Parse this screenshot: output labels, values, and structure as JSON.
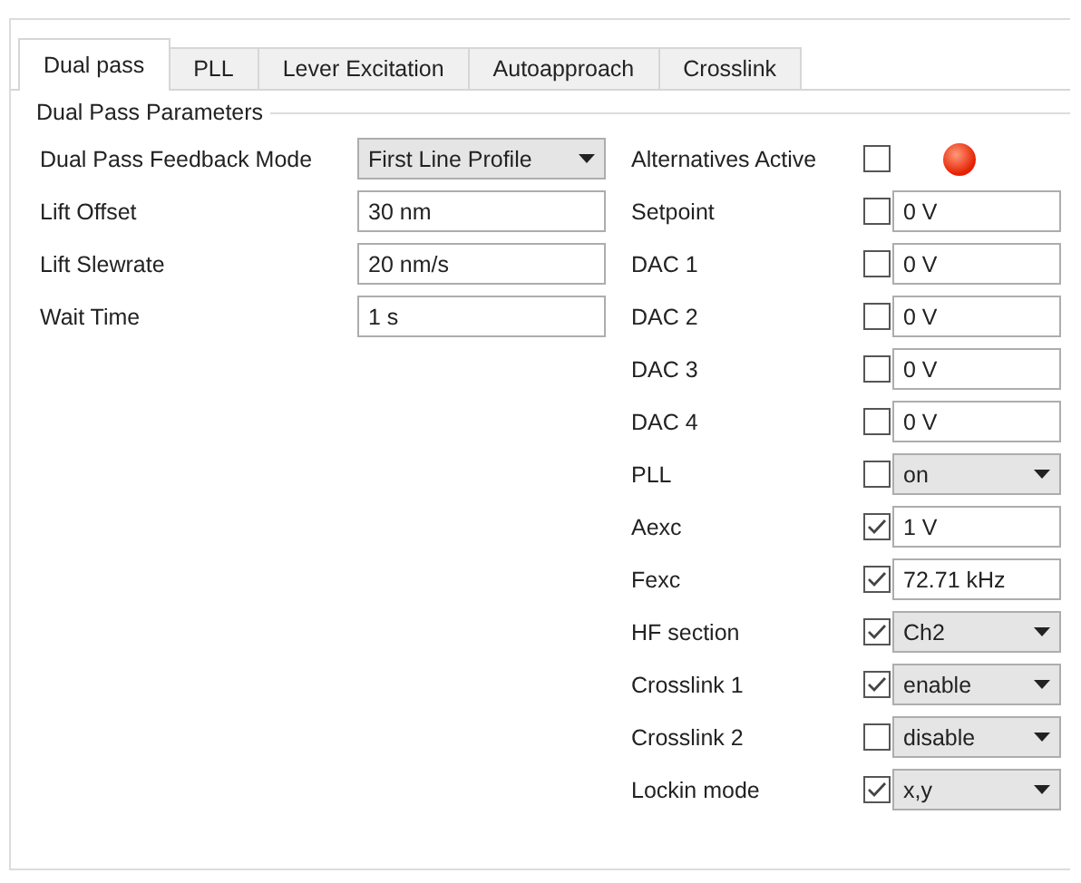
{
  "tabs": [
    {
      "label": "Dual pass",
      "selected": true
    },
    {
      "label": "PLL",
      "selected": false
    },
    {
      "label": "Lever Excitation",
      "selected": false
    },
    {
      "label": "Autoapproach",
      "selected": false
    },
    {
      "label": "Crosslink",
      "selected": false
    }
  ],
  "group": {
    "title": "Dual Pass Parameters"
  },
  "left_rows": [
    {
      "label": "Dual Pass Feedback Mode",
      "kind": "select",
      "value": "First Line Profile"
    },
    {
      "label": "Lift Offset",
      "kind": "input",
      "value": "30 nm"
    },
    {
      "label": "Lift Slewrate",
      "kind": "input",
      "value": "20 nm/s"
    },
    {
      "label": "Wait Time",
      "kind": "input",
      "value": "1 s"
    }
  ],
  "alternatives": {
    "label": "Alternatives Active",
    "checked": false,
    "indicator_on": true
  },
  "right_rows": [
    {
      "label": "Setpoint",
      "checked": false,
      "kind": "input",
      "value": "0 V"
    },
    {
      "label": "DAC 1",
      "checked": false,
      "kind": "input",
      "value": "0 V"
    },
    {
      "label": "DAC 2",
      "checked": false,
      "kind": "input",
      "value": "0 V"
    },
    {
      "label": "DAC 3",
      "checked": false,
      "kind": "input",
      "value": "0 V"
    },
    {
      "label": "DAC 4",
      "checked": false,
      "kind": "input",
      "value": "0 V"
    },
    {
      "label": "PLL",
      "checked": false,
      "kind": "select",
      "value": "on"
    },
    {
      "label": "Aexc",
      "checked": true,
      "kind": "input",
      "value": "1 V"
    },
    {
      "label": "Fexc",
      "checked": true,
      "kind": "input",
      "value": "72.71 kHz"
    },
    {
      "label": "HF section",
      "checked": true,
      "kind": "select",
      "value": "Ch2"
    },
    {
      "label": "Crosslink 1",
      "checked": true,
      "kind": "select",
      "value": "enable"
    },
    {
      "label": "Crosslink 2",
      "checked": false,
      "kind": "select",
      "value": "disable"
    },
    {
      "label": "Lockin mode",
      "checked": true,
      "kind": "select",
      "value": "x,y"
    }
  ]
}
